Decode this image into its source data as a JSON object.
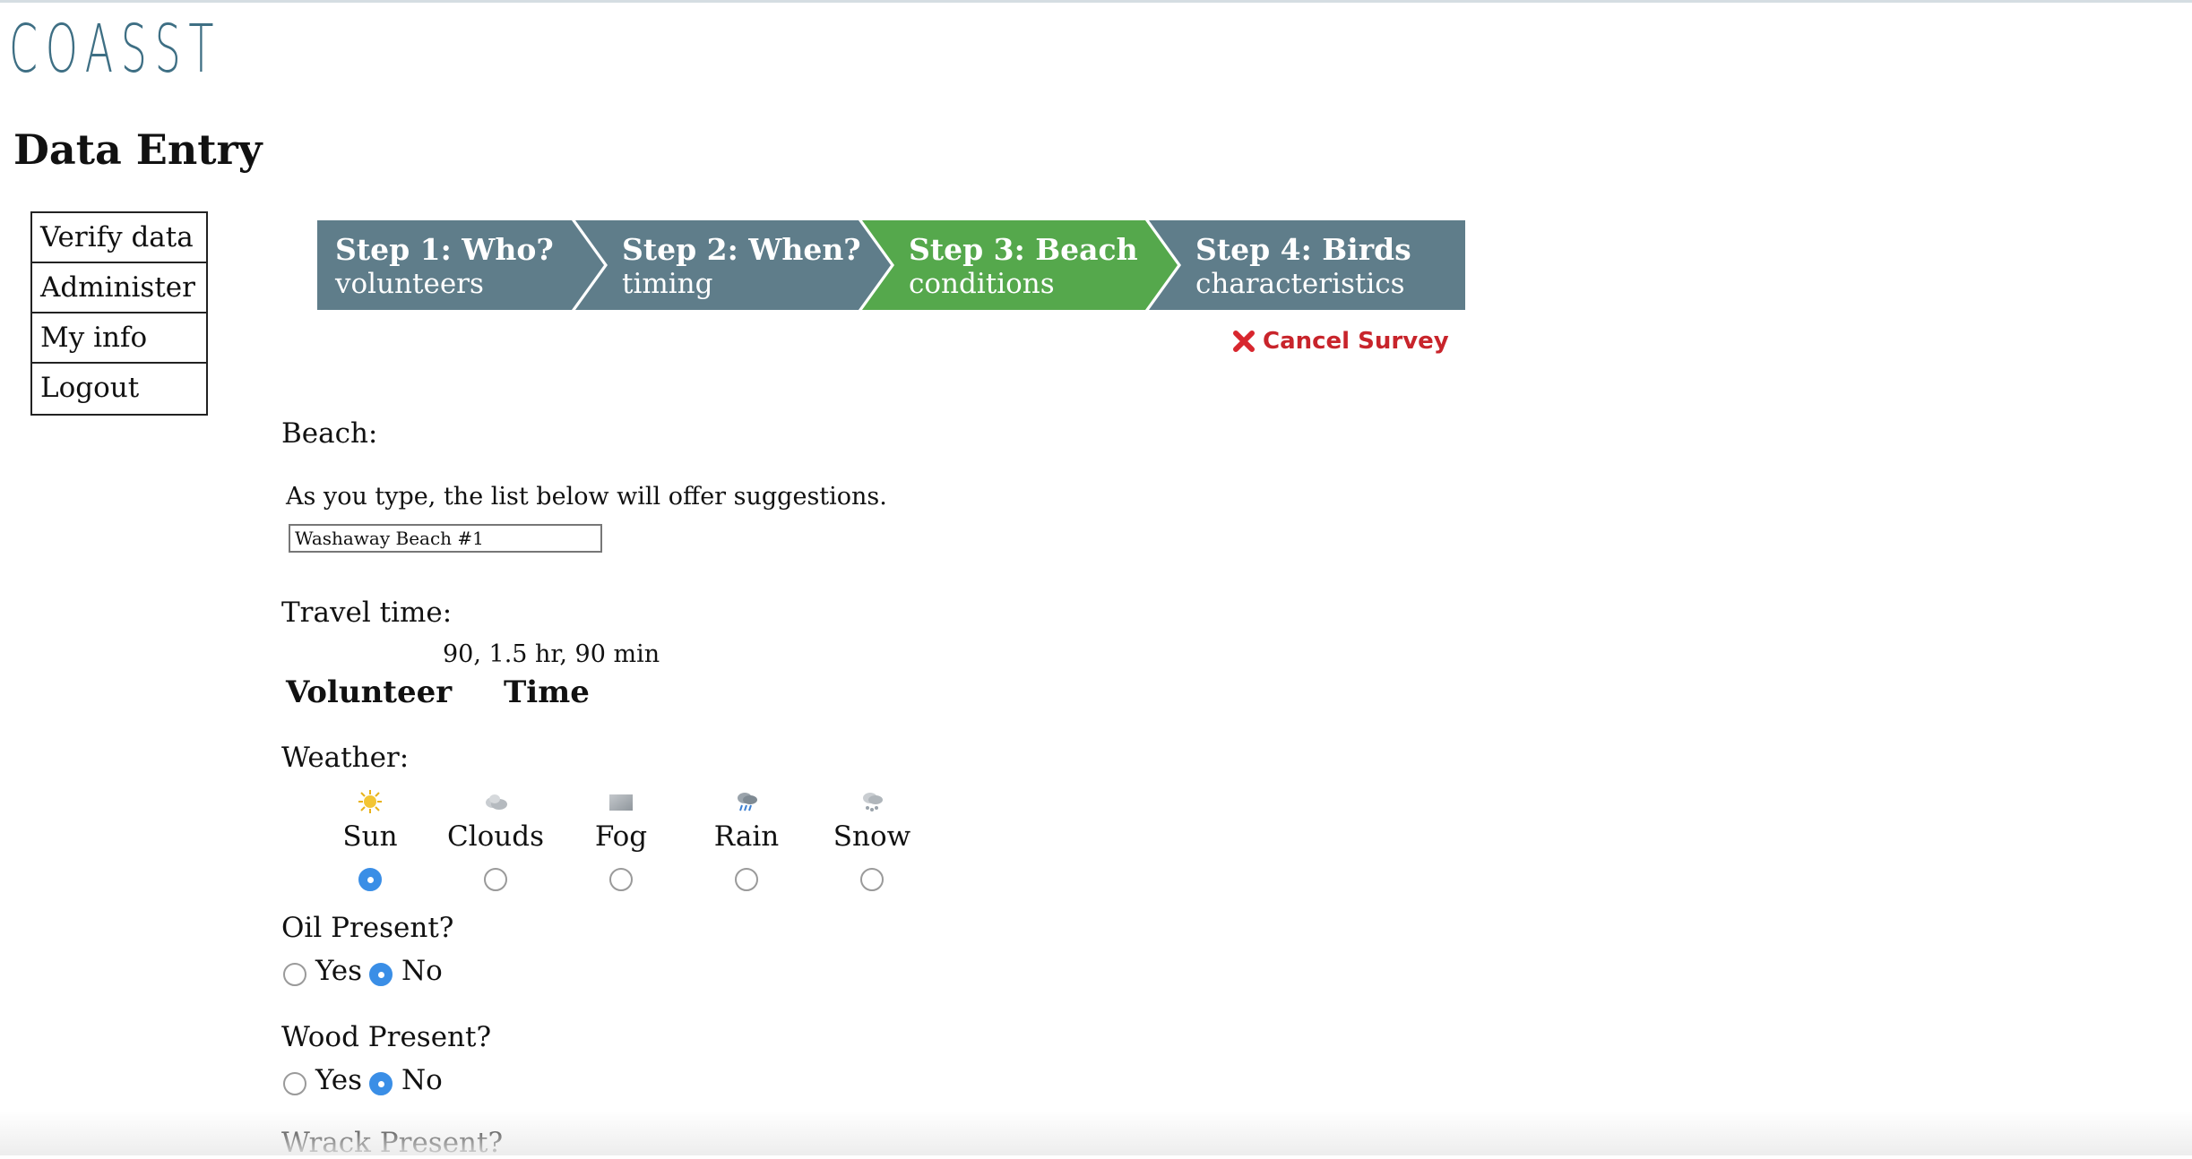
{
  "header": {
    "logo_text": "COASST",
    "page_title": "Data Entry"
  },
  "sidebar": {
    "items": [
      {
        "label": "Verify data"
      },
      {
        "label": "Administer"
      },
      {
        "label": "My info"
      },
      {
        "label": "Logout"
      }
    ]
  },
  "steps": {
    "items": [
      {
        "title": "Step 1: Who?",
        "subtitle": "volunteers",
        "active": false
      },
      {
        "title": "Step 2: When?",
        "subtitle": "timing",
        "active": false
      },
      {
        "title": "Step 3: Beach",
        "subtitle": "conditions",
        "active": true
      },
      {
        "title": "Step 4: Birds",
        "subtitle": "characteristics",
        "active": false
      }
    ],
    "colors": {
      "inactive": "#5f7d8a",
      "active": "#55a84c"
    }
  },
  "cancel": {
    "label": "Cancel Survey",
    "icon": "close-icon",
    "color": "#c8242b"
  },
  "beach": {
    "label": "Beach:",
    "hint": "As you type, the list below will offer suggestions.",
    "value": "Washaway Beach #1"
  },
  "travel": {
    "label": "Travel time:",
    "hint": "90, 1.5 hr, 90 min",
    "col_volunteer": "Volunteer",
    "col_time": "Time"
  },
  "weather": {
    "label": "Weather:",
    "options": [
      {
        "label": "Sun",
        "icon": "sun-icon",
        "checked": true
      },
      {
        "label": "Clouds",
        "icon": "clouds-icon",
        "checked": false
      },
      {
        "label": "Fog",
        "icon": "fog-icon",
        "checked": false
      },
      {
        "label": "Rain",
        "icon": "rain-icon",
        "checked": false
      },
      {
        "label": "Snow",
        "icon": "snow-icon",
        "checked": false
      }
    ]
  },
  "oil": {
    "label": "Oil Present?",
    "yes": "Yes",
    "no": "No",
    "selected": "No"
  },
  "wood": {
    "label": "Wood Present?",
    "yes": "Yes",
    "no": "No",
    "selected": "No"
  },
  "wrack": {
    "label": "Wrack Present?"
  }
}
